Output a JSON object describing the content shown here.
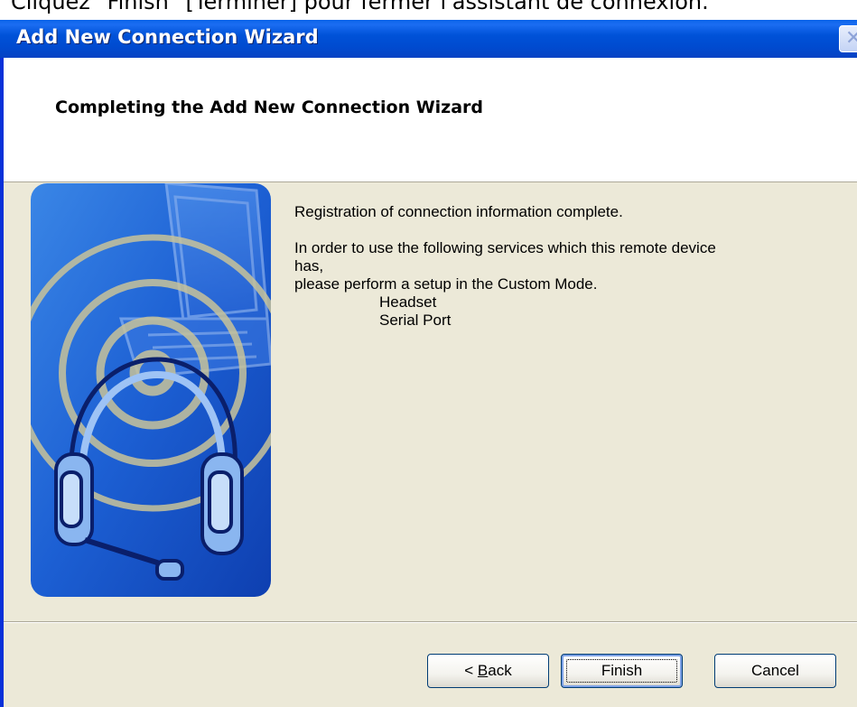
{
  "caption": {
    "text": "Cliquez \"Finish\" [Terminer] pour fermer l'assistant de connexion."
  },
  "window": {
    "title": "Add New Connection Wizard",
    "close_symbol": "✕"
  },
  "header": {
    "title": "Completing the Add New Connection Wizard"
  },
  "body": {
    "line1": "Registration of connection information complete.",
    "line2": "In order to use the following services which this remote device",
    "line3": "has,",
    "line4": "please perform a setup in the Custom Mode.",
    "services": [
      "Headset",
      "Serial Port"
    ]
  },
  "buttons": {
    "back_prefix": "< ",
    "back_accel": "B",
    "back_rest": "ack",
    "finish": "Finish",
    "cancel": "Cancel"
  },
  "icons": {
    "wizard_art": "bluetooth-headset-laptop-illustration"
  },
  "colors": {
    "titlebar": "#0052d8",
    "dialog_face": "#ece9d8",
    "art_blue": "#1f5fd6"
  }
}
